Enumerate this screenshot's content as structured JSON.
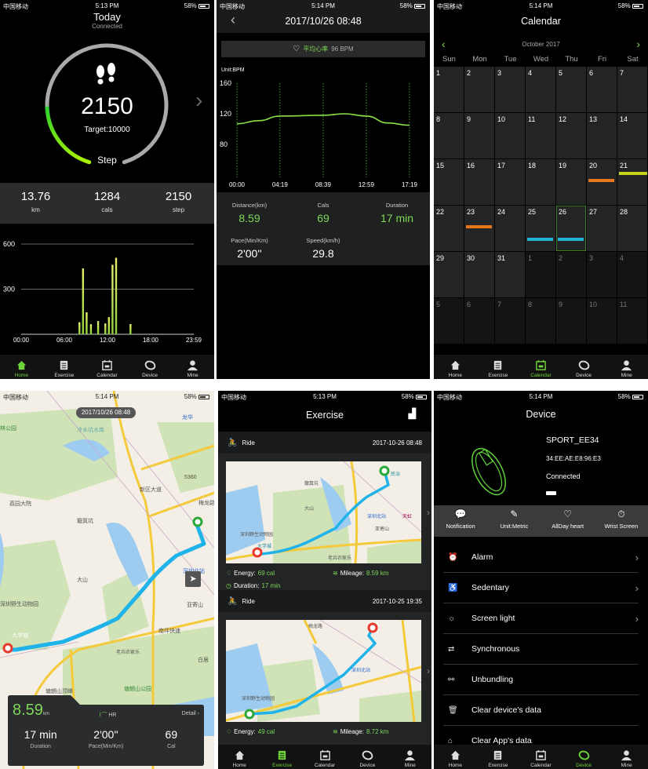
{
  "colors": {
    "accent": "#6fd33a",
    "ring_gray": "#a9a9a9",
    "route": "#1fb3ea",
    "start": "#2aa83a",
    "end": "#e8392c",
    "orange": "#e8761a",
    "yellow": "#c8d41a",
    "cyan": "#22b4d6"
  },
  "status": {
    "carrier": "中国移动",
    "battery": "58%",
    "times": [
      "5:13 PM",
      "5:14 PM",
      "5:14 PM",
      "5:14 PM",
      "5:13 PM",
      "5:14 PM"
    ]
  },
  "tabs": [
    {
      "label": "Home",
      "icon": "home-icon"
    },
    {
      "label": "Exercise",
      "icon": "clipboard-icon"
    },
    {
      "label": "Calendar",
      "icon": "calendar-icon"
    },
    {
      "label": "Device",
      "icon": "band-icon"
    },
    {
      "label": "Mine",
      "icon": "user-icon"
    }
  ],
  "home": {
    "title": "Today",
    "subtitle": "Connected",
    "steps": "2150",
    "target_label": "Target:10000",
    "ring_label": "Step",
    "progress": 0.215,
    "stats": [
      {
        "value": "13.76",
        "unit": "km"
      },
      {
        "value": "1284",
        "unit": "cals"
      },
      {
        "value": "2150",
        "unit": "step"
      }
    ],
    "active_tab": 0
  },
  "hr": {
    "title": "2017/10/26 08:48",
    "avg_label": "平均心率",
    "avg_value": "96 BPM",
    "unit": "Unit:BPM",
    "stats": [
      {
        "label": "Distance(km)",
        "value": "8.59",
        "green": true
      },
      {
        "label": "Cals",
        "value": "69",
        "green": true
      },
      {
        "label": "Duration",
        "value": "17 min",
        "green": true
      },
      {
        "label": "Pace(Min/Km)",
        "value": "2'00''",
        "green": false
      },
      {
        "label": "Speed(km/h)",
        "value": "29.8",
        "green": false
      }
    ]
  },
  "calendar": {
    "title": "Calendar",
    "month": "October 2017",
    "prev": "‹",
    "next": "›",
    "weekdays": [
      "Sun",
      "Mon",
      "Tue",
      "Wed",
      "Thu",
      "Fri",
      "Sat"
    ],
    "days": [
      "1",
      "2",
      "3",
      "4",
      "5",
      "6",
      "7",
      "8",
      "9",
      "10",
      "11",
      "12",
      "13",
      "14",
      "15",
      "16",
      "17",
      "18",
      "19",
      "20",
      "21",
      "22",
      "23",
      "24",
      "25",
      "26",
      "27",
      "28",
      "29",
      "30",
      "31",
      "1",
      "2",
      "3",
      "4",
      "5",
      "6",
      "7",
      "8",
      "9",
      "10",
      "11"
    ],
    "selected": "26",
    "markers": [
      {
        "day": "20",
        "color": "orange"
      },
      {
        "day": "21",
        "color": "yellow"
      },
      {
        "day": "23",
        "color": "orange"
      },
      {
        "day": "25",
        "color": "cyan"
      },
      {
        "day": "26",
        "color": "cyan"
      }
    ],
    "active_tab": 2
  },
  "map": {
    "timestamp": "2017/10/26 08:48",
    "labels": [
      "林公园",
      "冷水坑水库",
      "荔园大院",
      "簸箕坑",
      "大山",
      "深圳野生动物园",
      "大学城",
      "亚寄山",
      "老兵农家乐",
      "塘朗山顶峰",
      "塘朗山公园",
      "深圳北站",
      "南坪快速",
      "梅龙路",
      "新区大道",
      "5360",
      "龙华",
      "白居"
    ],
    "card": {
      "distance": "8.59",
      "distance_unit": "km",
      "hr_label": "HR",
      "detail_label": "Detail",
      "stats": [
        {
          "value": "17 min",
          "label": "Duration"
        },
        {
          "value": "2'00''",
          "label": "Pace(Min/Km)"
        },
        {
          "value": "69",
          "label": "Cal"
        }
      ]
    }
  },
  "exercise": {
    "title": "Exercise",
    "items": [
      {
        "type": "Ride",
        "datetime": "2017-10-26 08:48",
        "energy_label": "Energy:",
        "energy": "69 cal",
        "mileage_label": "Mileage:",
        "mileage": "8.59 km",
        "duration_label": "Duration:",
        "duration": "17 min",
        "map_labels": [
          "簸箕坑",
          "大山",
          "深圳野生动物园",
          "大学城",
          "深圳北站",
          "亚寄山",
          "民治",
          "天虹",
          "老兵农家乐"
        ]
      },
      {
        "type": "Ride",
        "datetime": "2017-10-25 19:35",
        "energy_label": "Energy:",
        "energy": "49 cal",
        "mileage_label": "Mileage:",
        "mileage": "8.72 km",
        "map_labels": [
          "深圳北站",
          "深圳野生动物园",
          "梅龙路"
        ]
      }
    ],
    "active_tab": 1
  },
  "device": {
    "title": "Device",
    "name": "SPORT_EE34",
    "mac": "34:EE:AE:E8:96:E3",
    "status": "Connected",
    "quick": [
      {
        "label": "Notification",
        "icon": "message-icon"
      },
      {
        "label": "Unit:Metric",
        "icon": "ruler-icon"
      },
      {
        "label": "AllDay heart",
        "icon": "heart-rate-icon"
      },
      {
        "label": "Wrist Screen",
        "icon": "wrist-screen-icon"
      }
    ],
    "menu": [
      {
        "label": "Alarm",
        "icon": "alarm-icon",
        "glyph": "⏰",
        "chevron": true
      },
      {
        "label": "Sedentary",
        "icon": "sedentary-icon",
        "glyph": "♿",
        "chevron": true
      },
      {
        "label": "Screen light",
        "icon": "bulb-icon",
        "glyph": "☼",
        "chevron": true
      },
      {
        "label": "Synchronous",
        "icon": "sync-icon",
        "glyph": "⇄",
        "chevron": false
      },
      {
        "label": "Unbundling",
        "icon": "unlink-icon",
        "glyph": "⚯",
        "chevron": false
      },
      {
        "label": "Clear device's data",
        "icon": "trash-icon",
        "glyph": "🗑",
        "chevron": false
      },
      {
        "label": "Clear App's data",
        "icon": "basket-icon",
        "glyph": "⌂",
        "chevron": false
      }
    ],
    "active_tab": 3
  },
  "chart_data": [
    {
      "type": "bar",
      "title": "",
      "xlabel": "",
      "ylabel": "",
      "x_ticks": [
        "00:00",
        "06:00",
        "12:00",
        "18:00",
        "23:59"
      ],
      "y_ticks": [
        300,
        600
      ],
      "ylim": [
        0,
        600
      ],
      "xlim_hours": [
        0,
        24
      ],
      "grid": true,
      "x": [
        8.1,
        8.6,
        9.1,
        9.7,
        10.7,
        11.7,
        12.2,
        12.7,
        13.2,
        15.2
      ],
      "values": [
        80,
        438,
        146,
        67,
        88,
        72,
        114,
        462,
        509,
        68
      ]
    },
    {
      "type": "line",
      "title": "",
      "ylabel": "Unit:BPM",
      "x_ticks": [
        "00:00",
        "04:19",
        "08:39",
        "12:59",
        "17:19"
      ],
      "y_ticks": [
        80,
        120,
        160
      ],
      "ylim": [
        60,
        160
      ],
      "grid": "vertical-dotted",
      "x": [
        "00:00",
        "02:10",
        "04:19",
        "08:39",
        "10:49",
        "12:59",
        "15:09",
        "17:19"
      ],
      "values": [
        107,
        111,
        117,
        118,
        120,
        117,
        108,
        105
      ]
    }
  ]
}
